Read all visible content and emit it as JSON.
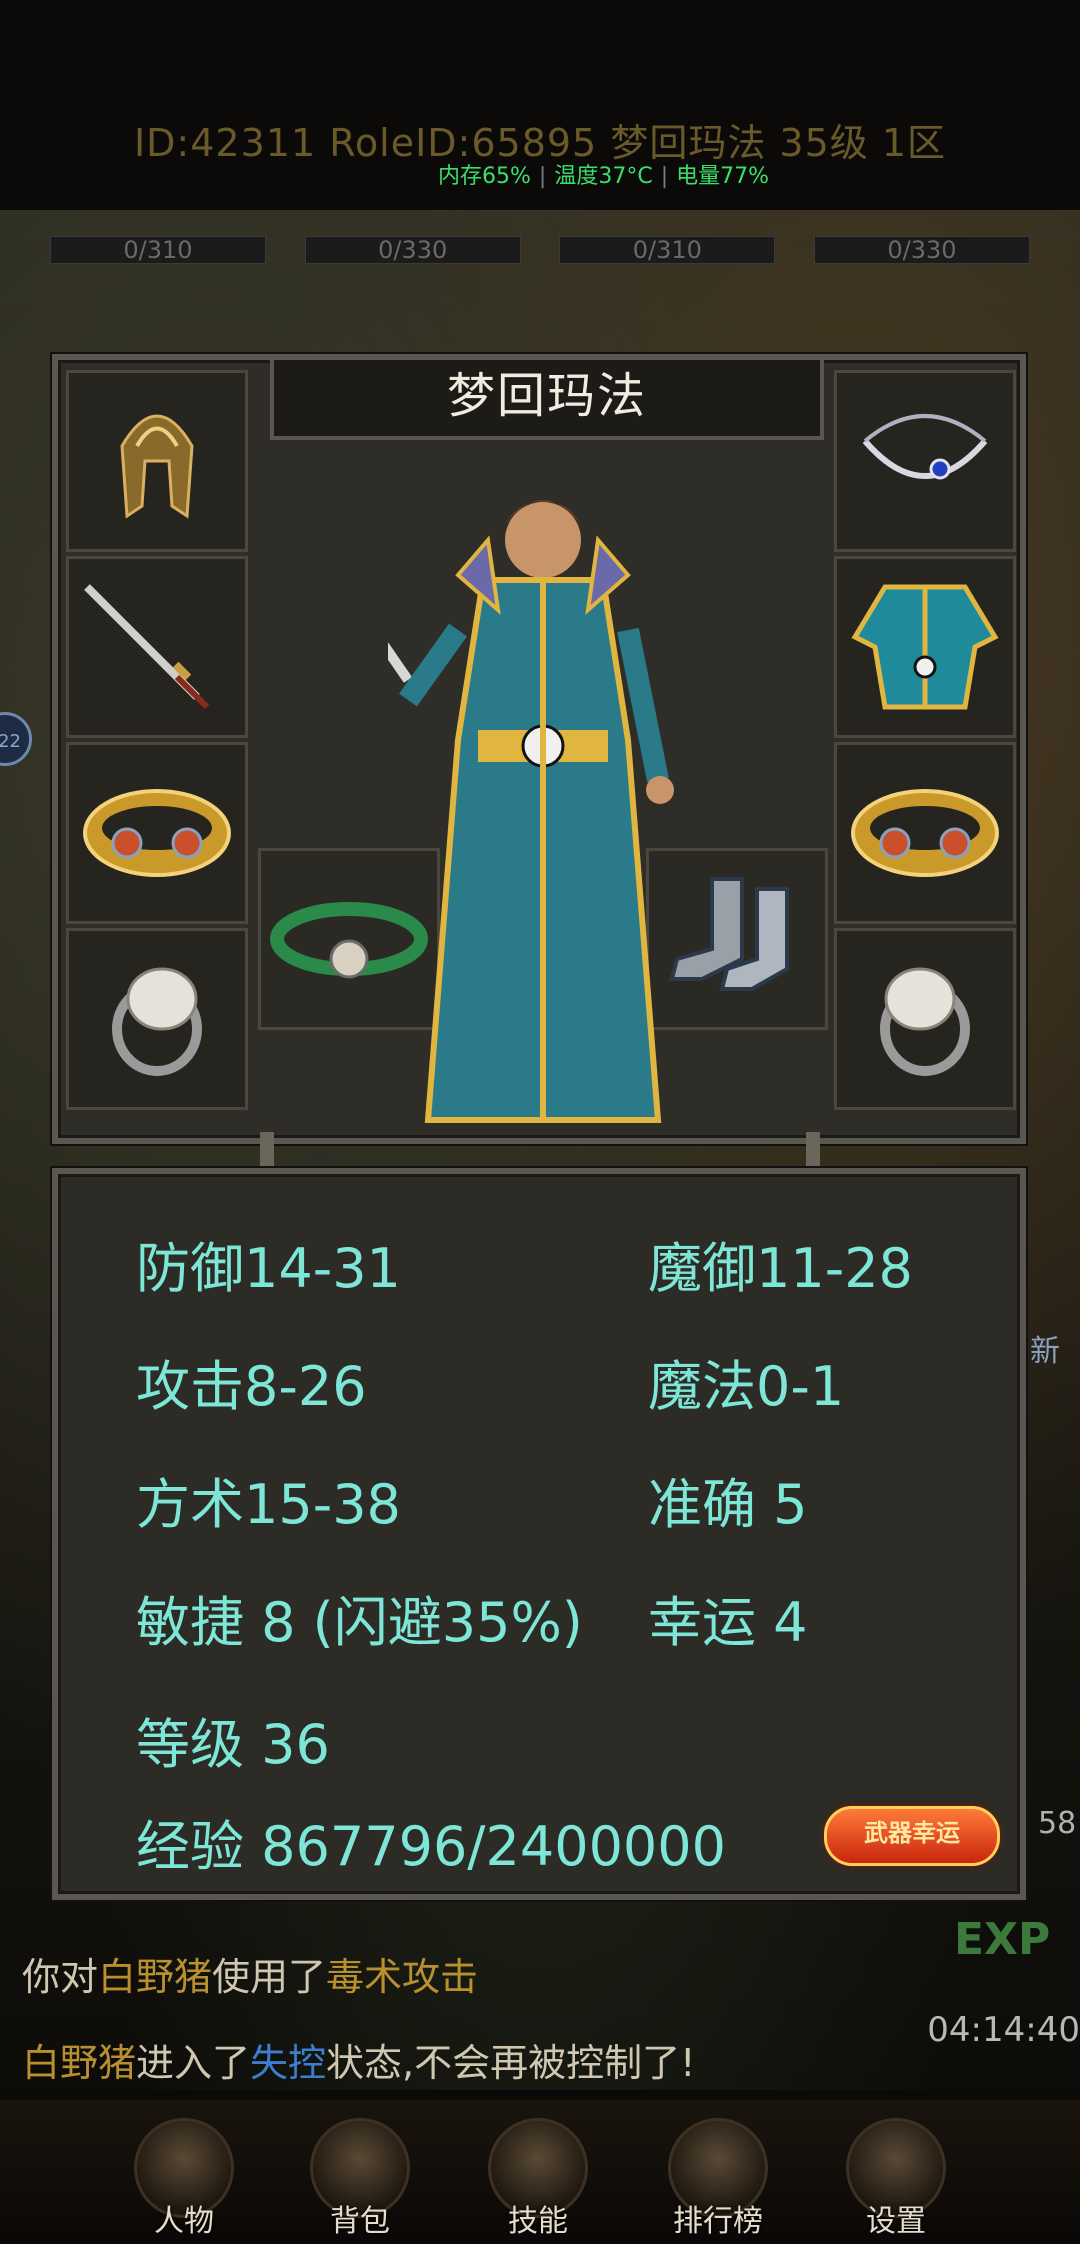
{
  "header": {
    "id_line": "ID:42311  RoleID:65895  梦回玛法  35级  1区",
    "memory": "内存65%",
    "temperature": "温度37°C",
    "battery": "电量77%",
    "hp_bars": [
      "0/310",
      "0/330",
      "0/310",
      "0/330"
    ],
    "side_badge": "22"
  },
  "character": {
    "name": "梦回玛法",
    "slots": {
      "left": [
        "helmet-icon",
        "sword-icon",
        "bracelet-icon",
        "ring-icon"
      ],
      "right": [
        "necklace-icon",
        "armor-icon",
        "bracelet-icon",
        "ring-icon"
      ],
      "inner_left": "belt-icon",
      "inner_right": "boots-icon"
    }
  },
  "stats": {
    "defense": "防御14-31",
    "magic_defense": "魔御11-28",
    "attack": "攻击8-26",
    "magic": "魔法0-1",
    "taoism": "方术15-38",
    "accuracy": "准确 5",
    "agility": "敏捷 8 (闪避35%)",
    "luck": "幸运 4",
    "level": "等级 36",
    "experience": "经验 867796/2400000",
    "weapon_luck_button": "武器幸运"
  },
  "chat": {
    "line1_prefix": "你对",
    "line1_target": "白野猪",
    "line1_mid": "使用了",
    "line1_skill": "毒术攻击",
    "line2_target": "白野猪",
    "line2_mid": "进入了",
    "line2_state": "失控",
    "line2_suffix": "状态,不会再被控制了!",
    "time": "04:14:40",
    "exp_label": "EXP",
    "side_right_number": "58",
    "side_right_new": "新"
  },
  "nav": {
    "character": "人物",
    "bag": "背包",
    "skills": "技能",
    "ranking": "排行榜",
    "settings": "设置"
  },
  "colors": {
    "stat_text": "#7de6d6",
    "system_info": "#38e06a",
    "chat_yellow": "#b8902e",
    "chat_blue": "#3c7fd1"
  }
}
